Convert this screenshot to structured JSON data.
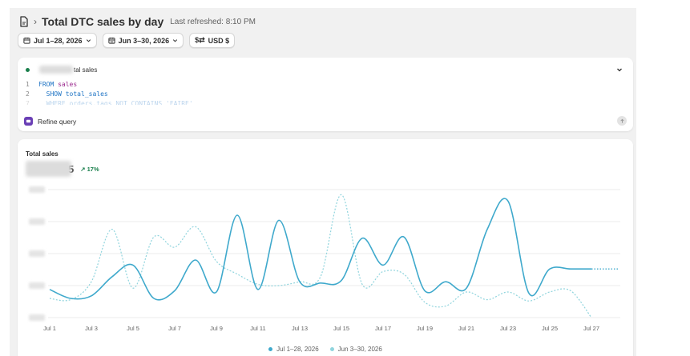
{
  "header": {
    "title": "Total DTC sales by day",
    "refreshed": "Last refreshed: 8:10 PM",
    "icon": "report-icon"
  },
  "filters": {
    "primary_range": "Jul 1–28, 2026",
    "comparison_range": "Jun 3–30, 2026",
    "currency": "USD $",
    "currency_symbol": "$⇄"
  },
  "query": {
    "name_suffix": "tal sales",
    "lines": [
      {
        "num": "1",
        "keyword": "FROM",
        "ident": "sales"
      },
      {
        "num": "2",
        "keyword": "SHOW",
        "ident": "total_sales"
      },
      {
        "num": "7",
        "text": "WHERE orders.tags NOT CONTAINS 'FAIRE'"
      }
    ],
    "refine_label": "Refine query"
  },
  "chart": {
    "title": "Total sales",
    "value_suffix": "5",
    "change": "↗ 17%",
    "colors": {
      "primary": "#3fa9cc",
      "comparison": "#8fd4dd",
      "grid": "#ebebeb"
    },
    "legend": [
      "Jul 1–28, 2026",
      "Jun 3–30, 2026"
    ]
  },
  "chart_data": {
    "type": "line",
    "title": "Total sales",
    "x": [
      "Jul 1",
      "Jul 2",
      "Jul 3",
      "Jul 4",
      "Jul 5",
      "Jul 6",
      "Jul 7",
      "Jul 8",
      "Jul 9",
      "Jul 10",
      "Jul 11",
      "Jul 12",
      "Jul 13",
      "Jul 14",
      "Jul 15",
      "Jul 16",
      "Jul 17",
      "Jul 18",
      "Jul 19",
      "Jul 20",
      "Jul 21",
      "Jul 22",
      "Jul 23",
      "Jul 24",
      "Jul 25",
      "Jul 26",
      "Jul 27",
      "Jul 28"
    ],
    "x_tick_labels": [
      "Jul 1",
      "Jul 3",
      "Jul 5",
      "Jul 7",
      "Jul 9",
      "Jul 11",
      "Jul 13",
      "Jul 15",
      "Jul 17",
      "Jul 19",
      "Jul 21",
      "Jul 23",
      "Jul 25",
      "Jul 27"
    ],
    "y_relative_note": "y axis tick labels are obscured; values are relative to the top gridline (1.0)",
    "ylim": [
      0,
      1
    ],
    "series": [
      {
        "name": "Jul 1–28, 2026",
        "style": "solid",
        "values": [
          0.22,
          0.15,
          0.17,
          0.32,
          0.41,
          0.15,
          0.21,
          0.45,
          0.2,
          0.8,
          0.22,
          0.76,
          0.28,
          0.27,
          0.29,
          0.62,
          0.41,
          0.63,
          0.21,
          0.28,
          0.23,
          0.69,
          0.91,
          0.19,
          0.38,
          0.38,
          0.38
        ]
      },
      {
        "name": "Jun 3–30, 2026",
        "style": "dashed",
        "values": [
          0.15,
          0.14,
          0.28,
          0.69,
          0.23,
          0.63,
          0.55,
          0.71,
          0.44,
          0.34,
          0.26,
          0.25,
          0.28,
          0.32,
          0.96,
          0.26,
          0.36,
          0.34,
          0.12,
          0.09,
          0.2,
          0.14,
          0.2,
          0.13,
          0.2,
          0.21,
          0.0
        ]
      }
    ]
  }
}
